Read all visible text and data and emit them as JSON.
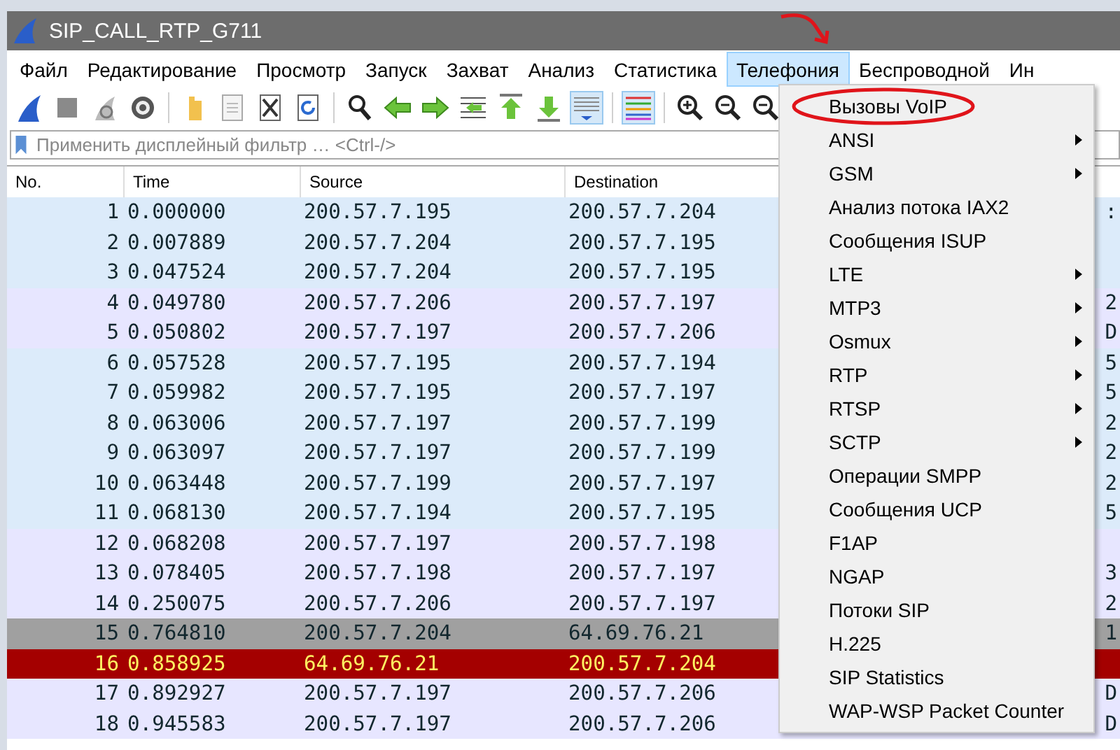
{
  "window": {
    "title": "SIP_CALL_RTP_G711"
  },
  "menu_bar": [
    {
      "label": "Файл",
      "selected": false
    },
    {
      "label": "Редактирование",
      "selected": false
    },
    {
      "label": "Просмотр",
      "selected": false
    },
    {
      "label": "Запуск",
      "selected": false
    },
    {
      "label": "Захват",
      "selected": false
    },
    {
      "label": "Анализ",
      "selected": false
    },
    {
      "label": "Статистика",
      "selected": false
    },
    {
      "label": "Телефония",
      "selected": true
    },
    {
      "label": "Беспроводной",
      "selected": false
    },
    {
      "label": "Ин",
      "selected": false
    }
  ],
  "toolbar": [
    {
      "kind": "fin",
      "pressed": false
    },
    {
      "kind": "stop",
      "pressed": false
    },
    {
      "kind": "restart",
      "pressed": false
    },
    {
      "kind": "gear",
      "pressed": false
    },
    {
      "kind": "separator"
    },
    {
      "kind": "folder",
      "pressed": false
    },
    {
      "kind": "file",
      "pressed": false
    },
    {
      "kind": "closefile",
      "pressed": false
    },
    {
      "kind": "reload",
      "pressed": false
    },
    {
      "kind": "separator"
    },
    {
      "kind": "search",
      "pressed": false
    },
    {
      "kind": "left",
      "pressed": false
    },
    {
      "kind": "right",
      "pressed": false
    },
    {
      "kind": "goto",
      "pressed": false
    },
    {
      "kind": "top",
      "pressed": false
    },
    {
      "kind": "bottom",
      "pressed": false
    },
    {
      "kind": "autoscroll",
      "pressed": true
    },
    {
      "kind": "separator"
    },
    {
      "kind": "colorize",
      "pressed": true
    },
    {
      "kind": "separator"
    },
    {
      "kind": "zoomin",
      "pressed": false
    },
    {
      "kind": "zoomout",
      "pressed": false
    },
    {
      "kind": "zoomreset",
      "pressed": false
    }
  ],
  "filter": {
    "placeholder": "Применить дисплейный фильтр … <Ctrl-/>"
  },
  "table": {
    "columns": [
      "No.",
      "Time",
      "Source",
      "Destination"
    ],
    "rows": [
      {
        "no": "1",
        "time": "0.000000",
        "source": "200.57.7.195",
        "destination": "200.57.7.204",
        "tail": ":",
        "kind": "blue"
      },
      {
        "no": "2",
        "time": "0.007889",
        "source": "200.57.7.204",
        "destination": "200.57.7.195",
        "kind": "blue"
      },
      {
        "no": "3",
        "time": "0.047524",
        "source": "200.57.7.204",
        "destination": "200.57.7.195",
        "kind": "blue"
      },
      {
        "no": "4",
        "time": "0.049780",
        "source": "200.57.7.206",
        "destination": "200.57.7.197",
        "tail": "2",
        "kind": "lavender"
      },
      {
        "no": "5",
        "time": "0.050802",
        "source": "200.57.7.197",
        "destination": "200.57.7.206",
        "tail": "D",
        "kind": "lavender"
      },
      {
        "no": "6",
        "time": "0.057528",
        "source": "200.57.7.195",
        "destination": "200.57.7.194",
        "tail": "5",
        "kind": "blue"
      },
      {
        "no": "7",
        "time": "0.059982",
        "source": "200.57.7.195",
        "destination": "200.57.7.197",
        "tail": "5",
        "kind": "blue"
      },
      {
        "no": "8",
        "time": "0.063006",
        "source": "200.57.7.197",
        "destination": "200.57.7.199",
        "tail": "2",
        "kind": "blue"
      },
      {
        "no": "9",
        "time": "0.063097",
        "source": "200.57.7.197",
        "destination": "200.57.7.199",
        "tail": "2",
        "kind": "blue"
      },
      {
        "no": "10",
        "time": "0.063448",
        "source": "200.57.7.199",
        "destination": "200.57.7.197",
        "tail": "2",
        "kind": "blue"
      },
      {
        "no": "11",
        "time": "0.068130",
        "source": "200.57.7.194",
        "destination": "200.57.7.195",
        "tail": "5",
        "kind": "blue"
      },
      {
        "no": "12",
        "time": "0.068208",
        "source": "200.57.7.197",
        "destination": "200.57.7.198",
        "kind": "lavender"
      },
      {
        "no": "13",
        "time": "0.078405",
        "source": "200.57.7.198",
        "destination": "200.57.7.197",
        "tail": "3",
        "kind": "lavender"
      },
      {
        "no": "14",
        "time": "0.250075",
        "source": "200.57.7.206",
        "destination": "200.57.7.197",
        "tail": "2",
        "kind": "lavender"
      },
      {
        "no": "15",
        "time": "0.764810",
        "source": "200.57.7.204",
        "destination": "64.69.76.21",
        "tail": "1",
        "kind": "gray"
      },
      {
        "no": "16",
        "time": "0.858925",
        "source": "64.69.76.21",
        "destination": "200.57.7.204",
        "kind": "red"
      },
      {
        "no": "17",
        "time": "0.892927",
        "source": "200.57.7.197",
        "destination": "200.57.7.206",
        "tail": "D",
        "kind": "lavender"
      },
      {
        "no": "18",
        "time": "0.945583",
        "source": "200.57.7.197",
        "destination": "200.57.7.206",
        "tail": "D",
        "kind": "lavender"
      }
    ]
  },
  "dropdown": [
    {
      "label": "Вызовы VoIP",
      "submenu": false
    },
    {
      "label": "ANSI",
      "submenu": true
    },
    {
      "label": "GSM",
      "submenu": true
    },
    {
      "label": "Анализ потока IAX2",
      "submenu": false
    },
    {
      "label": "Сообщения ISUP",
      "submenu": false
    },
    {
      "label": "LTE",
      "submenu": true
    },
    {
      "label": "MTP3",
      "submenu": true
    },
    {
      "label": "Osmux",
      "submenu": true
    },
    {
      "label": "RTP",
      "submenu": true
    },
    {
      "label": "RTSP",
      "submenu": true
    },
    {
      "label": "SCTP",
      "submenu": true
    },
    {
      "label": "Операции SMPP",
      "submenu": false
    },
    {
      "label": "Сообщения UCP",
      "submenu": false
    },
    {
      "label": "F1AP",
      "submenu": false
    },
    {
      "label": "NGAP",
      "submenu": false
    },
    {
      "label": "Потоки SIP",
      "submenu": false
    },
    {
      "label": "H.225",
      "submenu": false
    },
    {
      "label": "SIP Statistics",
      "submenu": false
    },
    {
      "label": "WAP-WSP Packet Counter",
      "submenu": false
    }
  ]
}
